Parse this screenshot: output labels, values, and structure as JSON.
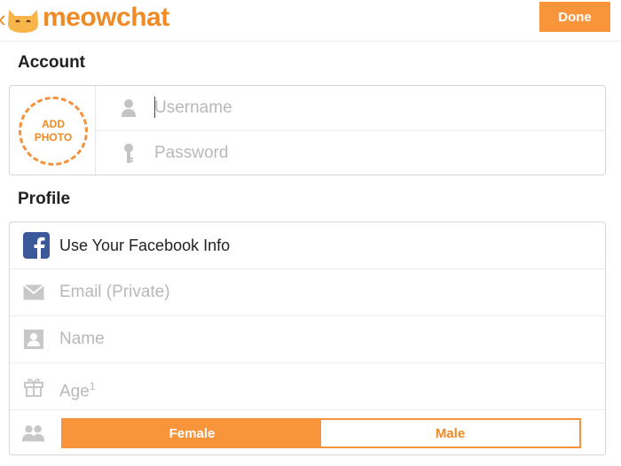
{
  "header": {
    "brand": "meowchat",
    "done_label": "Done",
    "accent_color": "#f8953a"
  },
  "account": {
    "title": "Account",
    "add_photo_line1": "ADD",
    "add_photo_line2": "PHOTO",
    "username_placeholder": "Username",
    "password_placeholder": "Password",
    "username_icon": "person-icon",
    "password_icon": "key-icon"
  },
  "profile": {
    "title": "Profile",
    "facebook_label": "Use Your Facebook Info",
    "email_placeholder": "Email (Private)",
    "name_placeholder": "Name",
    "age_placeholder": "Age",
    "age_superscript": "1",
    "gender": {
      "female_label": "Female",
      "male_label": "Male",
      "selected": "Female"
    },
    "icons": [
      "facebook-icon",
      "envelope-icon",
      "contact-card-icon",
      "gift-icon",
      "people-icon"
    ]
  }
}
